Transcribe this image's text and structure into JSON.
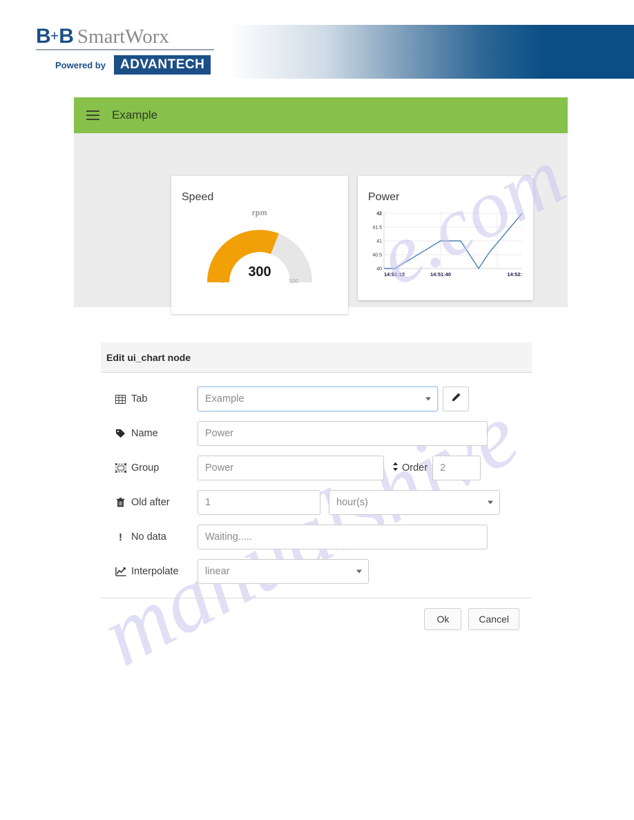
{
  "brand": {
    "bb": "B",
    "plus": "+",
    "bb2": "B",
    "smartworx": "SmartWorx",
    "powered_by": "Powered by",
    "advantech": "ADVANTECH"
  },
  "dashboard": {
    "menu_icon": "hamburger-icon",
    "tab_title": "Example",
    "gauge": {
      "title": "Speed",
      "unit": "rpm",
      "value": "300",
      "min": "0",
      "max": "500",
      "fill_color": "#f2a007",
      "track_color": "#e6e6e6"
    },
    "chart": {
      "title": "Power"
    }
  },
  "chart_data": {
    "type": "line",
    "title": "Power",
    "xlabel": "",
    "ylabel": "",
    "ylim": [
      40,
      42
    ],
    "yticks": [
      "40",
      "40.5",
      "41",
      "41.5",
      "42"
    ],
    "xticks": [
      "14:51:12",
      "14:51:40",
      "14:52:"
    ],
    "grid": true,
    "legend": "none",
    "line_color": "#4682b4",
    "series": [
      {
        "name": "Power",
        "x": [
          0,
          8,
          40,
          52,
          66,
          78,
          100
        ],
        "values": [
          40,
          40,
          41,
          41,
          40,
          40.6,
          42
        ]
      }
    ]
  },
  "gauge_data": {
    "type": "gauge",
    "title": "Speed",
    "unit": "rpm",
    "value": 300,
    "min": 0,
    "max": 500
  },
  "dialog": {
    "title": "Edit ui_chart node",
    "rows": [
      {
        "icon": "table-icon",
        "label": "Tab",
        "value": "Example",
        "control": "select",
        "has_edit_button": true,
        "edit_icon": "pencil-icon"
      },
      {
        "icon": "tag-icon",
        "label": "Name",
        "value": "Power",
        "control": "input"
      },
      {
        "icon": "object-group-icon",
        "label": "Group",
        "value": "Power",
        "control": "input",
        "order_icon": "sort-icon",
        "order_label": "Order",
        "order_value": "2"
      },
      {
        "icon": "trash-icon",
        "label": "Old after",
        "value": "1",
        "control": "input",
        "units_value": "hour(s)",
        "units_control": "select"
      },
      {
        "icon": "exclamation-icon",
        "label": "No data",
        "value": "Waiting.....",
        "control": "input"
      },
      {
        "icon": "chart-line-icon",
        "label": "Interpolate",
        "value": "linear",
        "control": "select"
      }
    ],
    "ok_label": "Ok",
    "cancel_label": "Cancel"
  },
  "watermark": {
    "text1": "e.com",
    "text2": "manualshive"
  }
}
